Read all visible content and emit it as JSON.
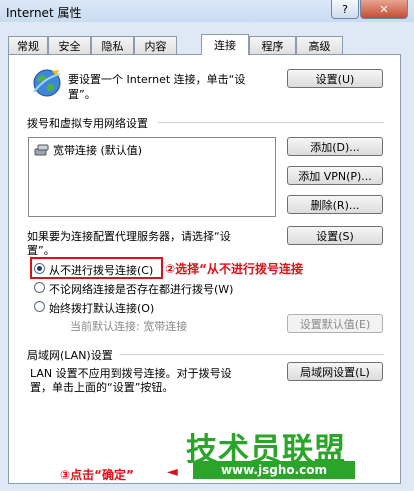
{
  "window": {
    "title": "Internet 属性",
    "help_label": "?",
    "close_label": "✕"
  },
  "tabs": [
    "常规",
    "安全",
    "隐私",
    "内容",
    "连接",
    "程序",
    "高级"
  ],
  "connect": {
    "intro": "要设置一个 Internet 连接，单击“设",
    "intro2": "置”。",
    "setup_btn": "设置(U)"
  },
  "dialup": {
    "heading": "拨号和虚拟专用网络设置",
    "items": [
      "宽带连接 (默认值)"
    ],
    "add_btn": "添加(D)...",
    "add_vpn_btn": "添加 VPN(P)...",
    "remove_btn": "删除(R)...",
    "proxy_text": "如果要为连接配置代理服务器，请选择“设",
    "proxy_text2": "置”。",
    "settings_btn": "设置(S)",
    "options": [
      {
        "label": "从不进行拨号连接(C)",
        "checked": true
      },
      {
        "label": "不论网络连接是否存在都进行拨号(W)",
        "checked": false
      },
      {
        "label": "始终拨打默认连接(O)",
        "checked": false
      }
    ],
    "current_default_label": "当前默认连接: 宽带连接",
    "set_default_btn": "设置默认值(E)"
  },
  "lan": {
    "heading": "局域网(LAN)设置",
    "text1": "LAN 设置不应用到拨号连接。对于拨号设",
    "text2": "置，单击上面的“设置”按钮。",
    "lan_btn": "局域网设置(L)"
  },
  "annotations": {
    "step2": "②选择“从不进行拨号连接",
    "step3": "③点击“确定”",
    "arrow": "◄"
  },
  "watermark": {
    "brand": "技术员联盟",
    "url": "www.jsgho.com"
  }
}
